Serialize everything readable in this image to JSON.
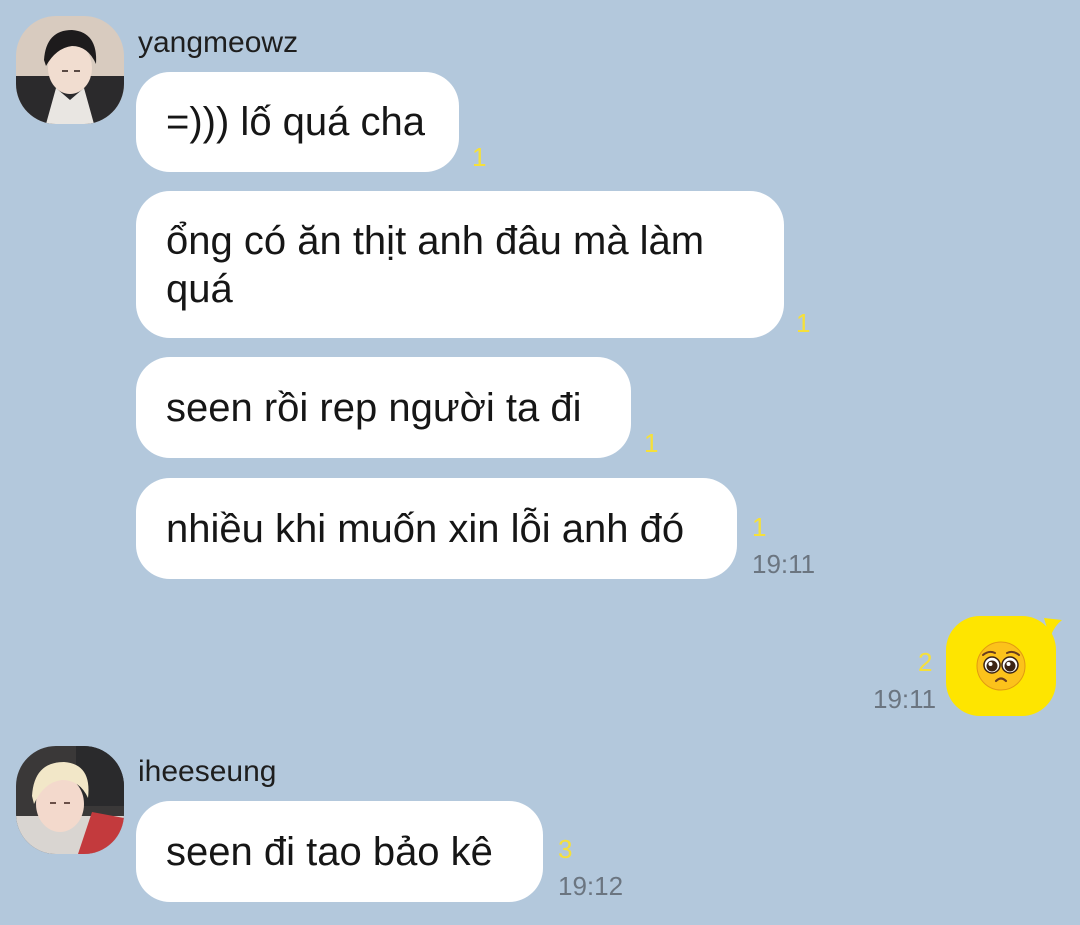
{
  "groups": [
    {
      "sender": "yangmeowz",
      "messages": [
        {
          "text": "=))) lố quá cha",
          "unread": "1"
        },
        {
          "text": "ổng có ăn thịt anh đâu mà làm quá",
          "unread": "1"
        },
        {
          "text": "seen rồi rep người ta đi",
          "unread": "1"
        },
        {
          "text": "nhiều khi muốn xin lỗi anh đó",
          "unread": "1",
          "time": "19:11"
        }
      ]
    },
    {
      "sender": "iheeseung",
      "messages": [
        {
          "text": "seen đi tao bảo kê",
          "unread": "3",
          "time": "19:12"
        }
      ]
    }
  ],
  "my_message": {
    "emoji": "pleading-face-emoji",
    "unread": "2",
    "time": "19:11"
  },
  "colors": {
    "background": "#b3c8dc",
    "other_bubble": "#ffffff",
    "my_bubble": "#fee500",
    "unread": "#f6e03a",
    "time": "#6b7580"
  }
}
